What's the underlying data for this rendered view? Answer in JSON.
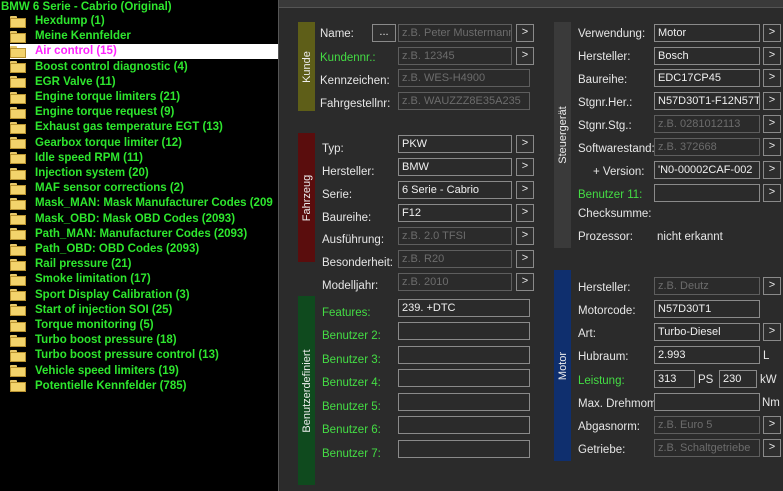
{
  "tree": {
    "root": "BMW 6 Serie - Cabrio (Original)",
    "items": [
      {
        "label": "Hexdump (1)"
      },
      {
        "label": "Meine Kennfelder"
      },
      {
        "label": "Air control (15)",
        "selected": true
      },
      {
        "label": "Boost control diagnostic (4)"
      },
      {
        "label": "EGR Valve (11)"
      },
      {
        "label": "Engine torque limiters (21)"
      },
      {
        "label": "Engine torque request (9)"
      },
      {
        "label": "Exhaust gas temperature EGT (13)"
      },
      {
        "label": "Gearbox torque limiter (12)"
      },
      {
        "label": "Idle speed RPM (11)"
      },
      {
        "label": "Injection system (20)"
      },
      {
        "label": "MAF sensor corrections (2)"
      },
      {
        "label": "Mask_MAN: Mask Manufacturer Codes (209"
      },
      {
        "label": "Mask_OBD: Mask OBD Codes (2093)"
      },
      {
        "label": "Path_MAN: Manufacturer Codes (2093)"
      },
      {
        "label": "Path_OBD: OBD Codes (2093)"
      },
      {
        "label": "Rail pressure (21)"
      },
      {
        "label": "Smoke limitation (17)"
      },
      {
        "label": "Sport Display Calibration (3)"
      },
      {
        "label": "Start of injection SOI (25)"
      },
      {
        "label": "Torque monitoring (5)"
      },
      {
        "label": "Turbo boost pressure (18)"
      },
      {
        "label": "Turbo boost pressure control (13)"
      },
      {
        "label": "Vehicle speed limiters (19)"
      },
      {
        "label": "Potentielle Kennfelder (785)"
      }
    ]
  },
  "colors": {
    "kunde": "#5e5e18",
    "fahrzeug": "#5a0d0d",
    "benutzer": "#0f4a1e",
    "steuergeraet": "#3a3a3a",
    "motor": "#0f2f6e",
    "tree_text": "#2ee62e",
    "tree_selected": "#ff22ff"
  },
  "sections": {
    "kunde": "Kunde",
    "fahrzeug": "Fahrzeug",
    "benutzer": "Benutzerdefiniert",
    "steuergeraet": "Steuergerät",
    "motor": "Motor"
  },
  "buttons": {
    "dots": "...",
    "arrow": ">"
  },
  "kunde": {
    "name_label": "Name:",
    "name_placeholder": "z.B. Peter Mustermann",
    "kundennr_label": "Kundennr.:",
    "kundennr_placeholder": "z.B. 12345",
    "kennzeichen_label": "Kennzeichen:",
    "kennzeichen_placeholder": "z.B. WES-H4900",
    "fgn_label": "Fahrgestellnr:",
    "fgn_placeholder": "z.B. WAUZZZ8E35A235"
  },
  "fahrzeug": {
    "typ_label": "Typ:",
    "typ_value": "PKW",
    "hersteller_label": "Hersteller:",
    "hersteller_value": "BMW",
    "serie_label": "Serie:",
    "serie_value": "6 Serie - Cabrio",
    "baureihe_label": "Baureihe:",
    "baureihe_value": "F12",
    "ausfuehrung_label": "Ausführung:",
    "ausfuehrung_placeholder": "z.B. 2.0 TFSI",
    "besonderheit_label": "Besonderheit:",
    "besonderheit_placeholder": "z.B. R20",
    "modelljahr_label": "Modelljahr:",
    "modelljahr_placeholder": "z.B. 2010"
  },
  "benutzer": {
    "features_label": "Features:",
    "features_value": "239. +DTC",
    "fields": [
      {
        "label": "Benutzer 2:"
      },
      {
        "label": "Benutzer 3:"
      },
      {
        "label": "Benutzer 4:"
      },
      {
        "label": "Benutzer 5:"
      },
      {
        "label": "Benutzer 6:"
      },
      {
        "label": "Benutzer 7:"
      }
    ]
  },
  "steuergeraet": {
    "verwendung_label": "Verwendung:",
    "verwendung_value": "Motor",
    "hersteller_label": "Hersteller:",
    "hersteller_value": "Bosch",
    "baureihe_label": "Baureihe:",
    "baureihe_value": "EDC17CP45",
    "stgnr_her_label": "Stgnr.Her.:",
    "stgnr_her_value": "N57D30T1-F12N57TI",
    "stgnr_stg_label": "Stgnr.Stg.:",
    "stgnr_stg_placeholder": "z.B. 0281012113",
    "softwarestand_label": "Softwarestand:",
    "softwarestand_placeholder": "z.B. 372668",
    "version_label": "+ Version:",
    "version_value": "'N0-00002CAF-002",
    "benutzer11_label": "Benutzer 11:",
    "checksumme_label": "Checksumme:",
    "prozessor_label": "Prozessor:",
    "prozessor_value": "nicht erkannt"
  },
  "motor": {
    "hersteller_label": "Hersteller:",
    "hersteller_placeholder": "z.B. Deutz",
    "motorcode_label": "Motorcode:",
    "motorcode_value": "N57D30T1",
    "art_label": "Art:",
    "art_value": "Turbo-Diesel",
    "hubraum_label": "Hubraum:",
    "hubraum_value": "2.993",
    "hubraum_unit": "L",
    "leistung_label": "Leistung:",
    "leistung_ps": "313",
    "ps_unit": "PS",
    "leistung_kw": "230",
    "kw_unit": "kW",
    "drehmoment_label": "Max. Drehmom.",
    "drehmoment_unit": "Nm",
    "abgasnorm_label": "Abgasnorm:",
    "abgasnorm_placeholder": "z.B. Euro 5",
    "getriebe_label": "Getriebe:",
    "getriebe_placeholder": "z.B. Schaltgetriebe"
  }
}
